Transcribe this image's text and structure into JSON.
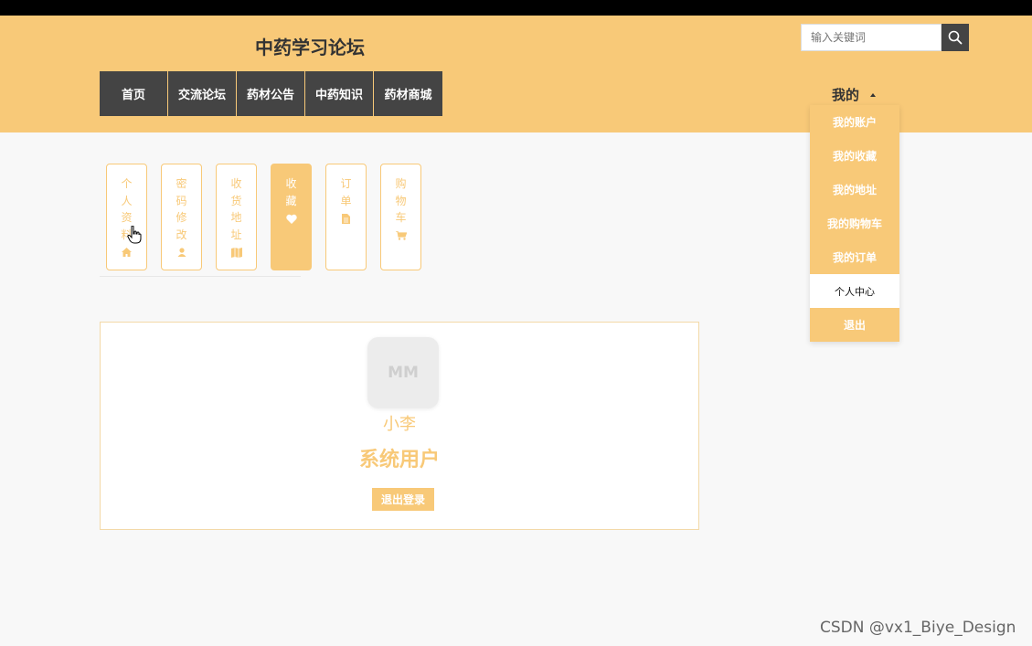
{
  "site": {
    "title": "中药学习论坛"
  },
  "search": {
    "placeholder": "输入关键词",
    "icon": "search-icon"
  },
  "nav": {
    "items": [
      {
        "label": "首页"
      },
      {
        "label": "交流论坛"
      },
      {
        "label": "药材公告"
      },
      {
        "label": "中药知识"
      },
      {
        "label": "药材商城"
      }
    ]
  },
  "user_menu": {
    "label": "我的",
    "items": [
      {
        "label": "我的账户"
      },
      {
        "label": "我的收藏"
      },
      {
        "label": "我的地址"
      },
      {
        "label": "我的购物车"
      },
      {
        "label": "我的订单"
      },
      {
        "label": "个人中心",
        "active": true
      },
      {
        "label": "退出"
      }
    ]
  },
  "tabs": [
    {
      "label": "个人资料",
      "chars": [
        "个",
        "人",
        "资",
        "料"
      ],
      "icon": "home-icon"
    },
    {
      "label": "密码修改",
      "chars": [
        "密",
        "码",
        "修",
        "改"
      ],
      "icon": "user-icon"
    },
    {
      "label": "收货地址",
      "chars": [
        "收",
        "货",
        "地",
        "址"
      ],
      "icon": "map-icon"
    },
    {
      "label": "收藏",
      "chars": [
        "收",
        "藏"
      ],
      "icon": "heart-icon",
      "active": true
    },
    {
      "label": "订单",
      "chars": [
        "订",
        "单"
      ],
      "icon": "file-icon"
    },
    {
      "label": "购物车",
      "chars": [
        "购",
        "物",
        "车"
      ],
      "icon": "cart-icon"
    }
  ],
  "profile": {
    "avatar_text": "MM",
    "username": "小李",
    "role": "系统用户",
    "logout_label": "退出登录"
  },
  "colors": {
    "accent": "#f8c978",
    "dark": "#444444",
    "topbar": "#000000"
  },
  "watermark": "CSDN @vx1_Biye_Design"
}
